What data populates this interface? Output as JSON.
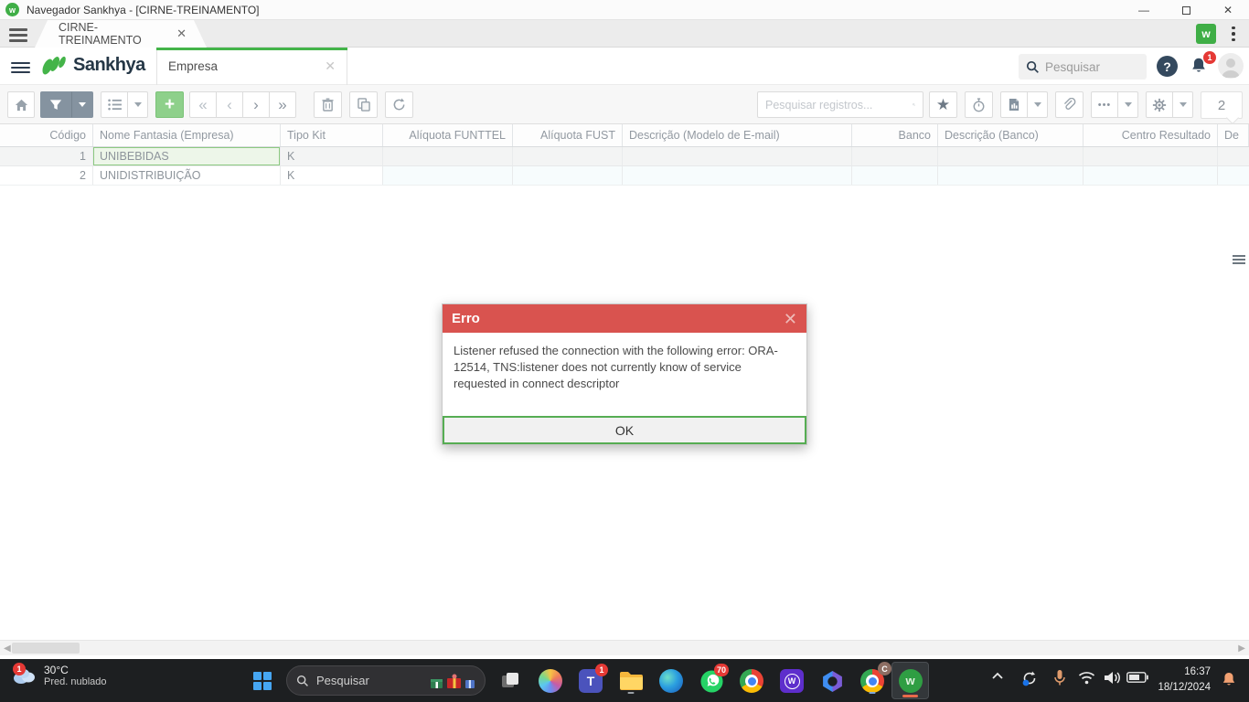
{
  "window": {
    "title": "Navegador Sankhya - [CIRNE-TREINAMENTO]"
  },
  "tabstrip": {
    "tab_label": "CIRNE-TREINAMENTO"
  },
  "header": {
    "brand": "Sankhya",
    "module_tab": "Empresa",
    "search_placeholder": "Pesquisar",
    "notification_badge": "1",
    "help_glyph": "?"
  },
  "toolbar": {
    "search_placeholder": "Pesquisar registros...",
    "record_count": "2"
  },
  "grid": {
    "columns": [
      "Código",
      "Nome Fantasia (Empresa)",
      "Tipo Kit",
      "Alíquota FUNTTEL",
      "Alíquota FUST",
      "Descrição (Modelo de E-mail)",
      "Banco",
      "Descrição (Banco)",
      "Centro Resultado",
      "De"
    ],
    "rows": [
      {
        "codigo": "1",
        "nome_fantasia": "UNIBEBIDAS",
        "tipo_kit": "K"
      },
      {
        "codigo": "2",
        "nome_fantasia": "UNIDISTRIBUIÇÃO",
        "tipo_kit": "K"
      }
    ]
  },
  "dialog": {
    "title": "Erro",
    "message": "Listener refused the connection with the following error: ORA-12514, TNS:listener does not currently know of service requested in connect descriptor",
    "ok_label": "OK"
  },
  "taskbar": {
    "weather": {
      "temp": "30°C",
      "desc": "Pred. nublado",
      "badge": "1"
    },
    "search_placeholder": "Pesquisar",
    "teams_badge": "1",
    "whatsapp_badge": "70",
    "chrome_profile_badge": "C",
    "clock": {
      "time": "16:37",
      "date": "18/12/2024"
    }
  },
  "colors": {
    "accent_green": "#44b449",
    "error_red": "#d9534f",
    "ok_border": "#56ad53",
    "taskbar_bg": "#1d1f21"
  }
}
